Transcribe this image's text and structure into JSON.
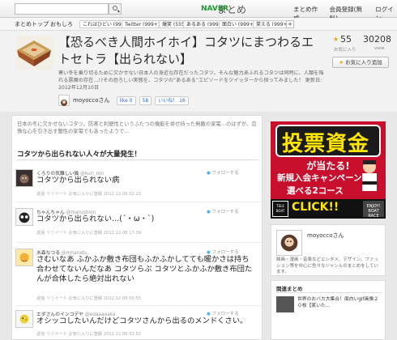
{
  "topbar": {
    "search_placeholder": "",
    "logo_brand": "NAVER",
    "logo_main": "まとめ",
    "links": [
      "まとめ作成",
      "会員登録(無料)",
      "ログイン"
    ]
  },
  "nav": {
    "home": "まとめトップ",
    "current": "おもしろ",
    "chips": [
      {
        "label": "これはひどい (999+)"
      },
      {
        "label": "Twitter (999+)"
      },
      {
        "label": "爆笑 (555)"
      },
      {
        "label": "あるある (999+)"
      },
      {
        "label": "面白い (999+)"
      },
      {
        "label": "笑える (999+)"
      }
    ],
    "add_label": "+"
  },
  "header": {
    "title": "【恐るべき人間ホイホイ】コタツにまつわるエトセトラ【出られない】",
    "description": "寒い冬を乗り切るために欠かせない日本人の身近な存在だったコタツ。そんな魅力あふれるコタツは同時に、人類を陥れる悪魔の存在…!?その恐ろしい実態を、コタツの“あるある”エピソードをツイッターから探ってみました！",
    "updated": "更新日: 2012年12月10日",
    "author": "moyoccoさん",
    "social": [
      {
        "label": "like 0"
      },
      {
        "label": "58"
      },
      {
        "label": "いいね！ 16"
      }
    ]
  },
  "stats": {
    "stars": "55",
    "stars_label": "お気に入り",
    "views": "30208",
    "views_label": "view",
    "fav_button": "お気に入り追加"
  },
  "article": {
    "intro": "日本の冬に欠かせないコタツ。防寒と利便性というふたつの機能を併せ持った無敵の家電…のはずが、怠惰な心を引き出す魔性の家電でもあったようで…",
    "heading": "コタツから出られない人々が大量発生！",
    "tweets": [
      {
        "user": "くろりの気難しい猫",
        "handle": "@kuri_ron",
        "text": "コタツから出られない病",
        "meta": "返信 リツイート お気に入りに登録 2012.12.09 02:23",
        "follow": "フォローする"
      },
      {
        "user": "ちゃんちゃん",
        "handle": "@marushion",
        "text": "コタツから出られない…(´・ω・`)",
        "meta": "返信 リツイート お気に入りに登録 2012.12.08 17:39",
        "follow": "フォローする"
      },
      {
        "user": "水森なつる",
        "handle": "@mhanatu",
        "text": "さむいなあ ふかふか敷き布団もふかふかしてても暖かさは持ち合わせてないんだなあ コタツらぶ コタツとふかふか敷き布団たんが合体したら絶対出れない",
        "meta": "返信 リツイート お気に入りに登録 2012.12.08 00:55",
        "follow": "フォローする"
      },
      {
        "user": "エダさんのインコデヤ",
        "handle": "@edaaaaaka",
        "text": "オシッコしたいんだけどコタツさんから出るのメンドくさい。",
        "meta": "返信 リツイート お気に入りに登録 2012.12.08 01:50",
        "follow": "フォローする"
      }
    ]
  },
  "ad": {
    "line1": "投票資金",
    "line2": "が当たる!",
    "line3": "新規入会キャンペーン",
    "line4": "選べる2コース",
    "click": "CLICK!!",
    "badge_left": "TELE BOAT",
    "badge_right": "ENJOY! BOAT RACE"
  },
  "profile": {
    "name": "moyoccoさん",
    "description": "映画・漫画・音楽などエンタメ、デザイン、ファッション等を中心に色々なジャンルのまとめをしています。"
  },
  "related": {
    "heading": "関連まとめ",
    "item_text": "世界のおバカ大集合！面白いgif画像２０枚【笑いた…"
  },
  "colors": {
    "ad_red": "#c8102e",
    "ad_yellow": "#ffe600",
    "naver_green": "#1a9c2a",
    "link_blue": "#3366cc"
  }
}
